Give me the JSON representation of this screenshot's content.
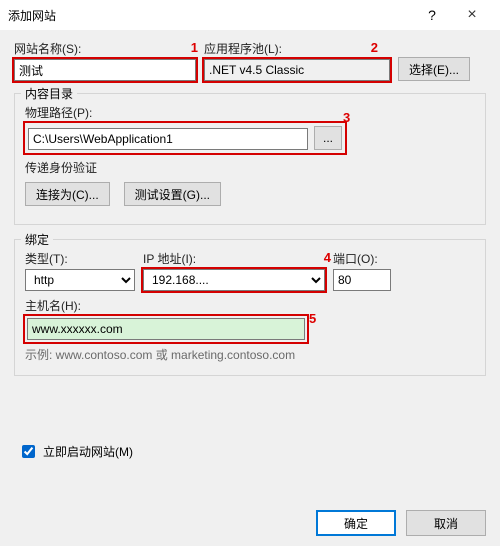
{
  "window": {
    "title": "添加网站"
  },
  "labels": {
    "siteName": "网站名称(S):",
    "appPool": "应用程序池(L):",
    "selectBtn": "选择(E)...",
    "contentDir": "内容目录",
    "physicalPath": "物理路径(P):",
    "browseBtn": "...",
    "passAuth": "传递身份验证",
    "connectAs": "连接为(C)...",
    "testSettings": "测试设置(G)...",
    "binding": "绑定",
    "type": "类型(T):",
    "ip": "IP 地址(I):",
    "port": "端口(O):",
    "host": "主机名(H):",
    "hint": "示例: www.contoso.com 或 marketing.contoso.com",
    "start": "立即启动网站(M)",
    "ok": "确定",
    "cancel": "取消"
  },
  "values": {
    "siteName": "测试",
    "appPool": ".NET v4.5 Classic",
    "physicalPath": "C:\\Users\\WebApplication1",
    "type": "http",
    "ip": "192.168....",
    "port": "80",
    "host": "www.xxxxxx.com",
    "startChecked": true
  },
  "annotations": {
    "n1": "1",
    "n2": "2",
    "n3": "3",
    "n4": "4",
    "n5": "5"
  }
}
